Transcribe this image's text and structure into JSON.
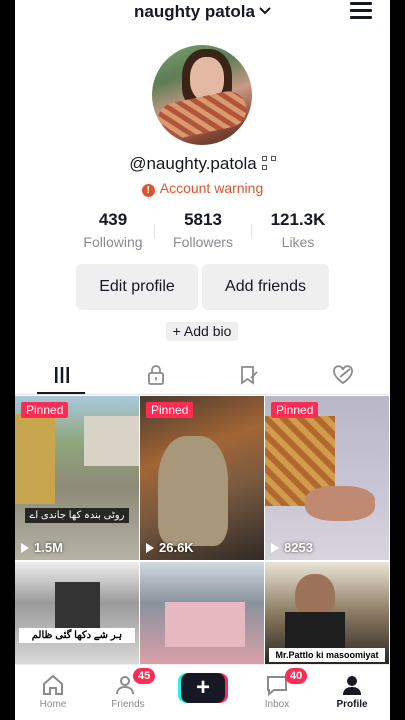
{
  "header": {
    "username": "naughty patola"
  },
  "profile": {
    "handle": "@naughty.patola",
    "warning": "Account warning"
  },
  "stats": [
    {
      "value": "439",
      "label": "Following"
    },
    {
      "value": "5813",
      "label": "Followers"
    },
    {
      "value": "121.3K",
      "label": "Likes"
    }
  ],
  "buttons": {
    "edit": "Edit profile",
    "add_friends": "Add friends",
    "add_bio": "+ Add bio"
  },
  "tabs": [
    {
      "icon": "grid-icon",
      "active": true
    },
    {
      "icon": "lock-icon",
      "active": false
    },
    {
      "icon": "bookmark-icon",
      "active": false
    },
    {
      "icon": "liked-heart-icon",
      "active": false
    }
  ],
  "videos": [
    {
      "pinned": "Pinned",
      "views": "1.5M",
      "caption": "روٹی بندہ کھا جاندی اے"
    },
    {
      "pinned": "Pinned",
      "views": "26.6K"
    },
    {
      "pinned": "Pinned",
      "views": "8253"
    },
    {
      "caption": "ہر شے دکھا گئی ظالم"
    },
    {},
    {
      "caption": "Mr.Pattlo ki masoomiyat"
    }
  ],
  "nav": [
    {
      "label": "Home",
      "icon": "home-icon"
    },
    {
      "label": "Friends",
      "icon": "friends-icon",
      "count": "45"
    },
    {
      "label": "",
      "icon": "plus-icon"
    },
    {
      "label": "Inbox",
      "icon": "inbox-icon",
      "count": "40"
    },
    {
      "label": "Profile",
      "icon": "profile-icon",
      "active": true
    }
  ],
  "colors": {
    "accent": "#fe2c55",
    "warning": "#e0542c",
    "button_bg": "#efeff0"
  }
}
